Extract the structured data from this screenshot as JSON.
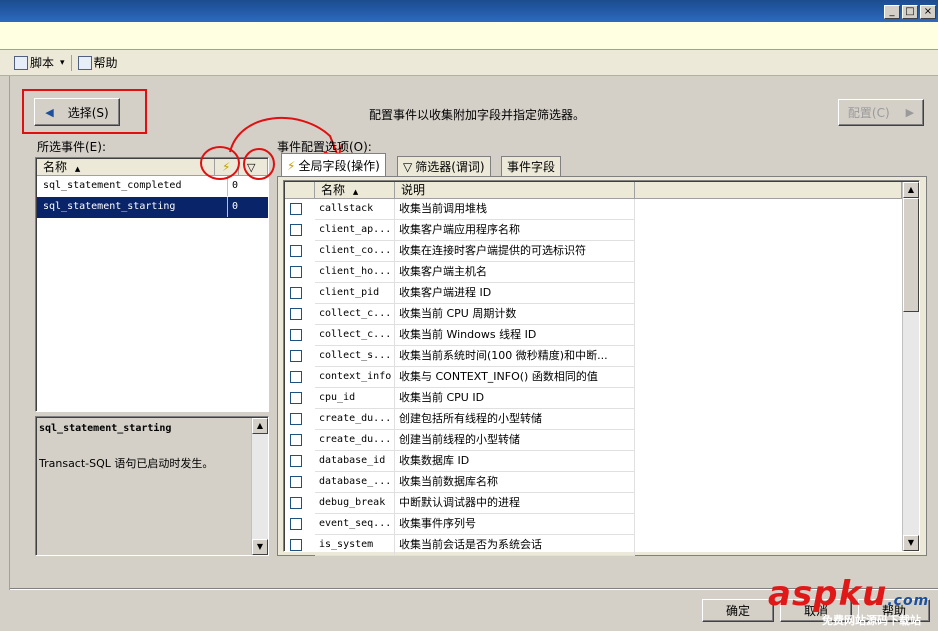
{
  "window": {
    "min": "_",
    "max": "□",
    "close": "×"
  },
  "toolbar": {
    "script_label": "脚本",
    "help_label": "帮助",
    "dropdown_arrow": "▾"
  },
  "nav": {
    "select_label": "选择(S)",
    "configure_label": "配置(C)",
    "description": "配置事件以收集附加字段并指定筛选器。"
  },
  "selected_events": {
    "label": "所选事件(E):",
    "header_name": "名称",
    "sort_icon": "▲",
    "rows": [
      {
        "name": "sql_statement_completed",
        "count": "0",
        "selected": false
      },
      {
        "name": "sql_statement_starting",
        "count": "0",
        "selected": true
      }
    ]
  },
  "event_desc": {
    "title": "sql_statement_starting",
    "text": "Transact-SQL 语句已启动时发生。"
  },
  "config": {
    "label": "事件配置选项(O):",
    "tabs": [
      "全局字段(操作)",
      "筛选器(谓词)",
      "事件字段"
    ],
    "header_name": "名称",
    "header_desc": "说明",
    "rows": [
      {
        "name": "callstack",
        "desc": "收集当前调用堆栈"
      },
      {
        "name": "client_ap...",
        "desc": "收集客户端应用程序名称"
      },
      {
        "name": "client_co...",
        "desc": "收集在连接时客户端提供的可选标识符"
      },
      {
        "name": "client_ho...",
        "desc": "收集客户端主机名"
      },
      {
        "name": "client_pid",
        "desc": "收集客户端进程 ID"
      },
      {
        "name": "collect_c...",
        "desc": "收集当前 CPU 周期计数"
      },
      {
        "name": "collect_c...",
        "desc": "收集当前 Windows 线程 ID"
      },
      {
        "name": "collect_s...",
        "desc": "收集当前系统时间(100 微秒精度)和中断..."
      },
      {
        "name": "context_info",
        "desc": "收集与 CONTEXT_INFO() 函数相同的值"
      },
      {
        "name": "cpu_id",
        "desc": "收集当前 CPU ID"
      },
      {
        "name": "create_du...",
        "desc": "创建包括所有线程的小型转储"
      },
      {
        "name": "create_du...",
        "desc": "创建当前线程的小型转储"
      },
      {
        "name": "database_id",
        "desc": "收集数据库 ID"
      },
      {
        "name": "database_...",
        "desc": "收集当前数据库名称"
      },
      {
        "name": "debug_break",
        "desc": "中断默认调试器中的进程"
      },
      {
        "name": "event_seq...",
        "desc": "收集事件序列号"
      },
      {
        "name": "is_system",
        "desc": "收集当前会话是否为系统会话"
      }
    ]
  },
  "footer": {
    "ok_label": "确定",
    "cancel_label": "取消",
    "help_label": "帮助"
  },
  "watermark": {
    "text": "aspku",
    "suffix": ".com",
    "sub": "免费网站源码下载站"
  },
  "colors": {
    "selection": "#0a246a",
    "annotation": "#e01010"
  }
}
